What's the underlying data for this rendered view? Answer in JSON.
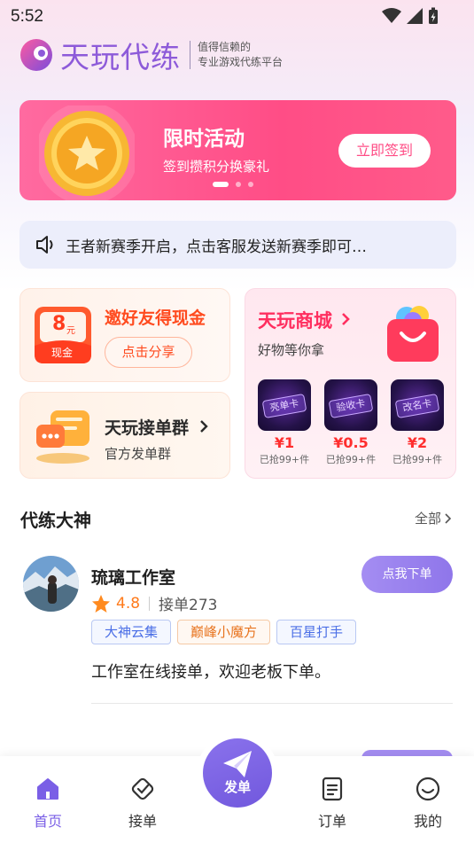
{
  "status": {
    "time": "5:52"
  },
  "header": {
    "app_name": "天玩代练",
    "slogan_line1": "值得信赖的",
    "slogan_line2": "专业游戏代练平台"
  },
  "banner": {
    "title": "限时活动",
    "subtitle": "签到攒积分换豪礼",
    "button": "立即签到",
    "page_count": 3,
    "active_page": 1
  },
  "notice": {
    "text": "王者新赛季开启，点击客服发送新赛季即可…"
  },
  "invite": {
    "title": "邀好友得现金",
    "button": "点击分享",
    "cash_amount": "8",
    "cash_unit": "元",
    "cash_label": "现金"
  },
  "group": {
    "title": "天玩接单群",
    "subtitle": "官方发单群"
  },
  "mall": {
    "title": "天玩商城",
    "subtitle": "好物等你拿",
    "products": [
      {
        "card_text": "亮单卡",
        "price": "¥1",
        "sold": "已抢99+件"
      },
      {
        "card_text": "验收卡",
        "price": "¥0.5",
        "sold": "已抢99+件"
      },
      {
        "card_text": "改名卡",
        "price": "¥2",
        "sold": "已抢99+件"
      }
    ]
  },
  "section": {
    "title": "代练大神",
    "all_link": "全部"
  },
  "studio": {
    "name": "琉璃工作室",
    "rating": "4.8",
    "orders": "接单273",
    "order_button": "点我下单",
    "tags": [
      "大神云集",
      "巅峰小魔方",
      "百星打手"
    ],
    "description": "工作室在线接单，欢迎老板下单。"
  },
  "tabbar": {
    "items": [
      "首页",
      "接单",
      "订单",
      "我的"
    ],
    "center": "发单",
    "active": "首页"
  },
  "colors": {
    "brand_purple": "#8d5ad9",
    "banner_pink": "#ff4d86",
    "accent_orange": "#ff4b1f",
    "price_red": "#ff2e2e",
    "button_purple": "#8f76ea"
  }
}
